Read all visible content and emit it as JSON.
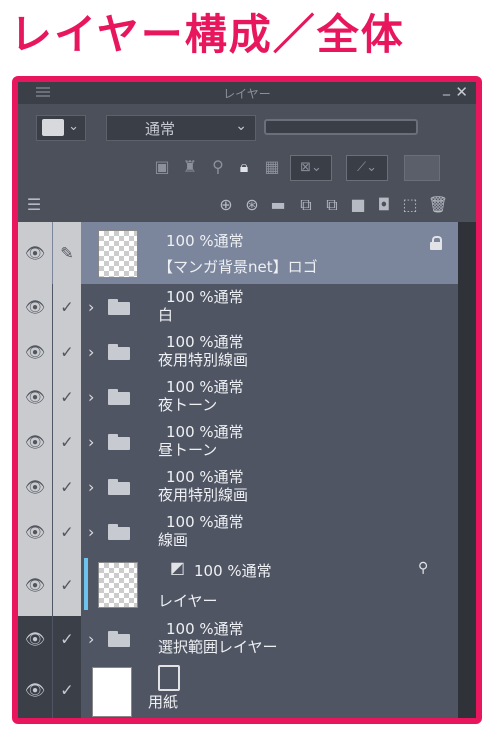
{
  "heading": "レイヤー構成／全体",
  "panel": {
    "title": "レイヤー",
    "blend_mode": "通常"
  },
  "layers": [
    {
      "opacity_mode": "100 %通常",
      "name": "【マンガ背景net】ロゴ"
    },
    {
      "opacity_mode": "100 %通常",
      "name": "白"
    },
    {
      "opacity_mode": "100 %通常",
      "name": "夜用特別線画"
    },
    {
      "opacity_mode": "100 %通常",
      "name": "夜トーン"
    },
    {
      "opacity_mode": "100 %通常",
      "name": "昼トーン"
    },
    {
      "opacity_mode": "100 %通常",
      "name": "夜用特別線画"
    },
    {
      "opacity_mode": "100 %通常",
      "name": "線画"
    },
    {
      "opacity_mode": "100 %通常",
      "name": "レイヤー"
    },
    {
      "opacity_mode": "100 %通常",
      "name": "選択範囲レイヤー"
    },
    {
      "opacity_mode": "",
      "name": "用紙"
    }
  ],
  "icons": {
    "close": "✕",
    "minimize": "_",
    "eye": "👁",
    "check": "✓",
    "caret": "›",
    "dropdown": "⌄"
  },
  "colors": {
    "accent": "#e8175d",
    "panel_bg": "#4b505b",
    "selected_row": "#7b869d",
    "current_layer_bar": "#6ec3ee"
  }
}
